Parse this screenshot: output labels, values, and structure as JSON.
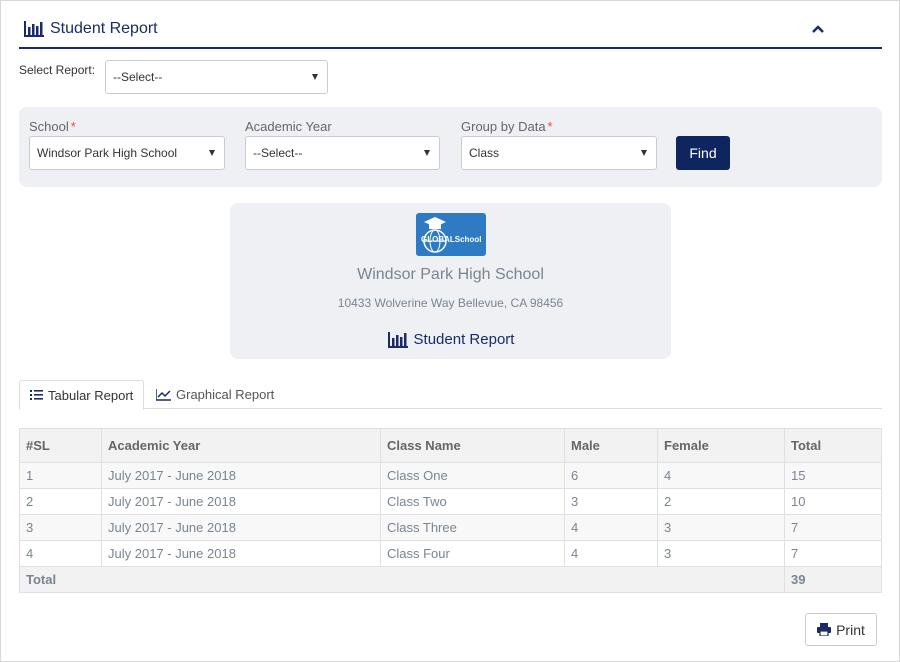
{
  "header": {
    "title": "Student Report",
    "icon": "bar-chart-icon",
    "collapse_icon": "chevron-up-icon"
  },
  "select_report": {
    "label": "Select Report:",
    "value": "--Select--"
  },
  "filters": {
    "school": {
      "label": "School",
      "required_mark": "*",
      "value": "Windsor Park High School"
    },
    "academic_year": {
      "label": "Academic Year",
      "value": "--Select--"
    },
    "group_by": {
      "label": "Group by Data",
      "required_mark": "*",
      "value": "Class"
    },
    "find_label": "Find"
  },
  "card": {
    "logo_text": "GLOBALSchool",
    "school_name": "Windsor Park High School",
    "address": "10433 Wolverine Way Bellevue, CA 98456",
    "report_title": "Student Report"
  },
  "tabs": [
    {
      "label": "Tabular Report",
      "icon": "list-icon",
      "active": true
    },
    {
      "label": "Graphical Report",
      "icon": "line-chart-icon",
      "active": false
    }
  ],
  "table": {
    "headers": [
      "#SL",
      "Academic Year",
      "Class Name",
      "Male",
      "Female",
      "Total"
    ],
    "rows": [
      [
        "1",
        "July 2017 - June 2018",
        "Class One",
        "6",
        "4",
        "15"
      ],
      [
        "2",
        "July 2017 - June 2018",
        "Class Two",
        "3",
        "2",
        "10"
      ],
      [
        "3",
        "July 2017 - June 2018",
        "Class Three",
        "4",
        "3",
        "7"
      ],
      [
        "4",
        "July 2017 - June 2018",
        "Class Four",
        "4",
        "3",
        "7"
      ]
    ],
    "total": {
      "label": "Total",
      "value": "39"
    }
  },
  "print_label": "Print",
  "colors": {
    "primary": "#1b2a6b",
    "button": "#0f2560",
    "panel": "#eef0f3",
    "required": "#e74c3c"
  }
}
